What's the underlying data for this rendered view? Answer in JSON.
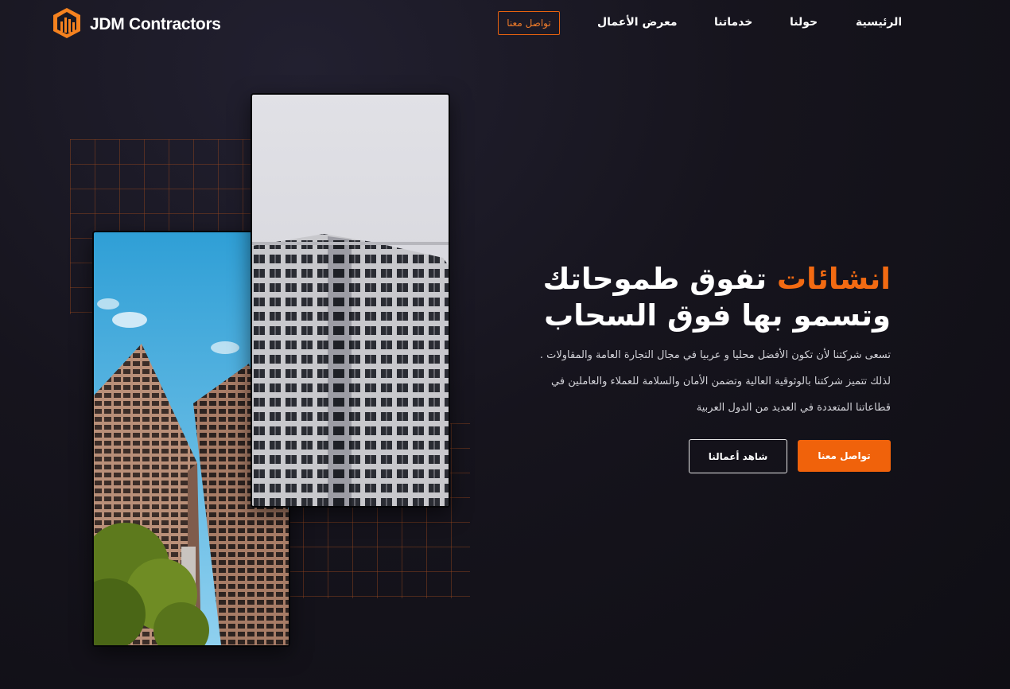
{
  "brand": {
    "name": "JDM Contractors",
    "logo_icon": "building-logo-icon",
    "accent": "#f26a12"
  },
  "nav": {
    "items": [
      "الرئيسية",
      "حولنا",
      "خدماتنا",
      "معرض الأعمال"
    ],
    "cta": "تواصل معنا"
  },
  "hero": {
    "title_accent": "انشائات",
    "title_rest": " تفوق طموحاتك",
    "title_line2": "وتسمو بها فوق السحاب",
    "description": [
      "تسعى شركتنا لأن تكون الأفضل محليا و عربيا في مجال التجارة العامة والمقاولات .",
      "لذلك تتميز شركتنا بالوثوقية العالية وتضمن الأمان والسلامة للعملاء والعاملين في",
      "قطاعاتنا المتعددة في العديد من الدول العربية"
    ],
    "primary_button": "تواصل معنا",
    "secondary_button": "شاهد أعمالنا"
  },
  "images": {
    "left": "twin-towers-sky-photo",
    "right": "residential-tower-photo"
  }
}
